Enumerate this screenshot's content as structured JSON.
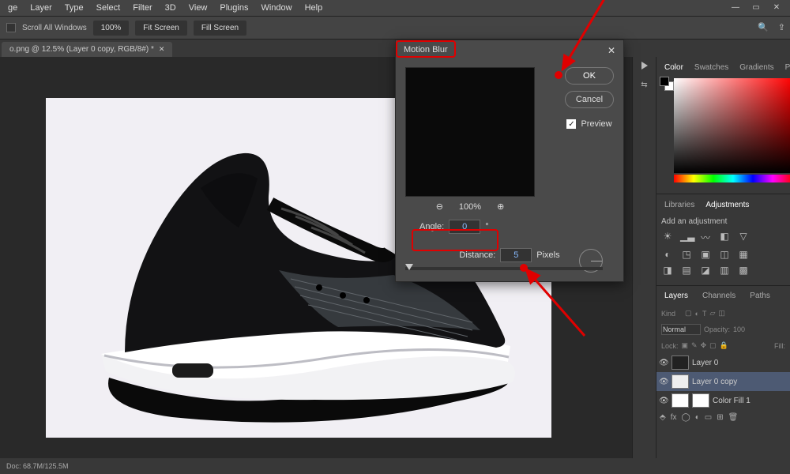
{
  "menubar": [
    "ge",
    "Layer",
    "Type",
    "Select",
    "Filter",
    "3D",
    "View",
    "Plugins",
    "Window",
    "Help"
  ],
  "optionsbar": {
    "scroll_label": "Scroll All Windows",
    "btn1": "100%",
    "btn2": "Fit Screen",
    "btn3": "Fill Screen"
  },
  "tab": {
    "name": "o.png @ 12.5% (Layer 0 copy, RGB/8#) *"
  },
  "dialog": {
    "title": "Motion Blur",
    "ok": "OK",
    "cancel": "Cancel",
    "preview_label": "Preview",
    "zoom": "100%",
    "angle_label": "Angle:",
    "angle_value": "0",
    "angle_unit": "°",
    "distance_label": "Distance:",
    "distance_value": "5",
    "distance_unit": "Pixels"
  },
  "rightpanels": {
    "color_tabs": [
      "Color",
      "Swatches",
      "Gradients",
      "Patterns"
    ],
    "lib_tabs": [
      "Libraries",
      "Adjustments"
    ],
    "adj_label": "Add an adjustment",
    "layers_tabs": [
      "Layers",
      "Channels",
      "Paths"
    ],
    "kind": "Kind",
    "blend": "Normal",
    "opacity_label": "Opacity:",
    "opacity_value": "100",
    "lock_label": "Lock:",
    "fill_label": "Fill:",
    "layers": [
      {
        "name": "Layer 0"
      },
      {
        "name": "Layer 0 copy"
      },
      {
        "name": "Color Fill 1"
      }
    ]
  },
  "status": "Doc: 68.7M/125.5M",
  "colors": {
    "accent": "#e00000"
  }
}
